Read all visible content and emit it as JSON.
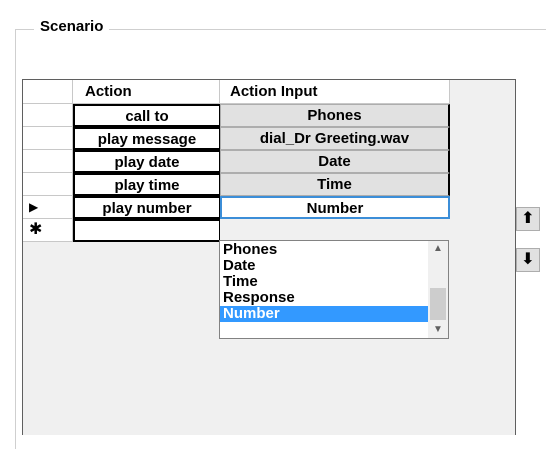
{
  "group": {
    "title": "Scenario"
  },
  "grid": {
    "columns": {
      "action": "Action",
      "input": "Action Input"
    },
    "rows": [
      {
        "marker": "",
        "action": "call to",
        "input": "Phones"
      },
      {
        "marker": "",
        "action": "play message",
        "input": "dial_Dr Greeting.wav"
      },
      {
        "marker": "",
        "action": "play date",
        "input": "Date"
      },
      {
        "marker": "",
        "action": "play time",
        "input": "Time"
      },
      {
        "marker": "▶",
        "action": "play number",
        "input": "Number"
      }
    ],
    "new_row_marker": "✱"
  },
  "dropdown": {
    "options": [
      "Phones",
      "Date",
      "Time",
      "Response",
      "Number"
    ],
    "selected": "Number"
  },
  "buttons": {
    "move_up": "⬆",
    "move_down": "⬇"
  },
  "colors": {
    "selection": "#3399ff",
    "active_border": "#3c8ed8",
    "grid_background": "#f0f0f0"
  }
}
